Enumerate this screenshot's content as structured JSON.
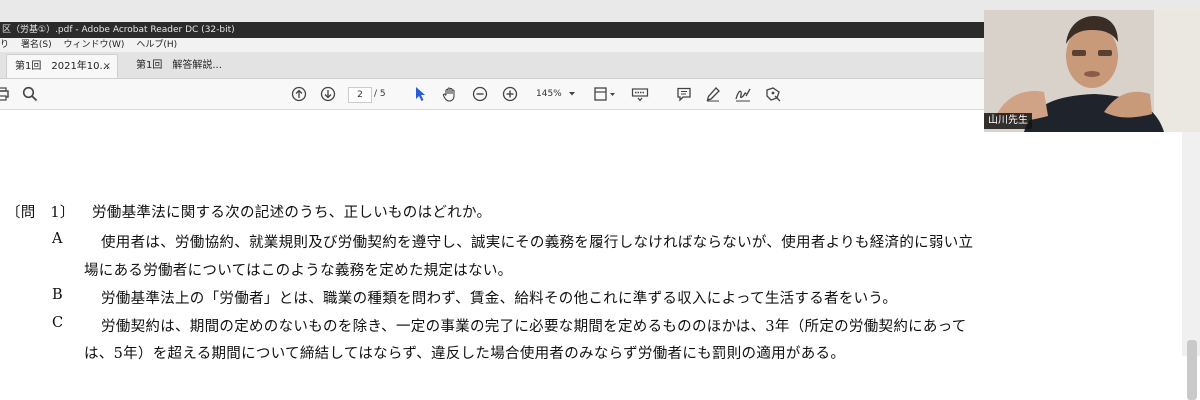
{
  "window": {
    "title": "区（労基①）.pdf - Adobe Acrobat Reader DC (32-bit)"
  },
  "menu": {
    "items": [
      "り",
      "署名(S)",
      "ウィンドウ(W)",
      "ヘルプ(H)"
    ]
  },
  "tabs": {
    "active_label": "第1回　2021年10...",
    "active_close": "×",
    "inactive_label": "第1回　解答解説..."
  },
  "toolbar": {
    "current_page": "2",
    "page_separator": "/ 5",
    "zoom": "145%",
    "icons": [
      "print-icon",
      "search-icon",
      "page-up-icon",
      "page-down-icon",
      "select-cursor-icon",
      "hand-tool-icon",
      "zoom-out-icon",
      "zoom-in-icon",
      "zoom-dropdown-icon",
      "page-layout-icon",
      "keyboard-icon",
      "comment-icon",
      "highlight-pen-icon",
      "sign-icon",
      "stamp-icon"
    ]
  },
  "document": {
    "question_label": "〔問　1〕",
    "question_text": "労働基準法に関する次の記述のうち、正しいものはどれか。",
    "options": [
      {
        "letter": "A",
        "line1": "使用者は、労働協約、就業規則及び労働契約を遵守し、誠実にその義務を履行しなければならないが、使用者よりも経済的に弱い立",
        "line2": "場にある労働者についてはこのような義務を定めた規定はない。"
      },
      {
        "letter": "B",
        "line1": "労働基準法上の「労働者」とは、職業の種類を問わず、賃金、給料その他これに準ずる収入によって生活する者をいう。"
      },
      {
        "letter": "C",
        "line1": "労働契約は、期間の定めのないものを除き、一定の事業の完了に必要な期間を定めるもののほかは、3年（所定の労働契約にあって",
        "line2": "は、5年）を超える期間について締結してはならず、違反した場合使用者のみならず労働者にも罰則の適用がある。"
      }
    ]
  },
  "webcam": {
    "speaker_name": "山川先生"
  }
}
